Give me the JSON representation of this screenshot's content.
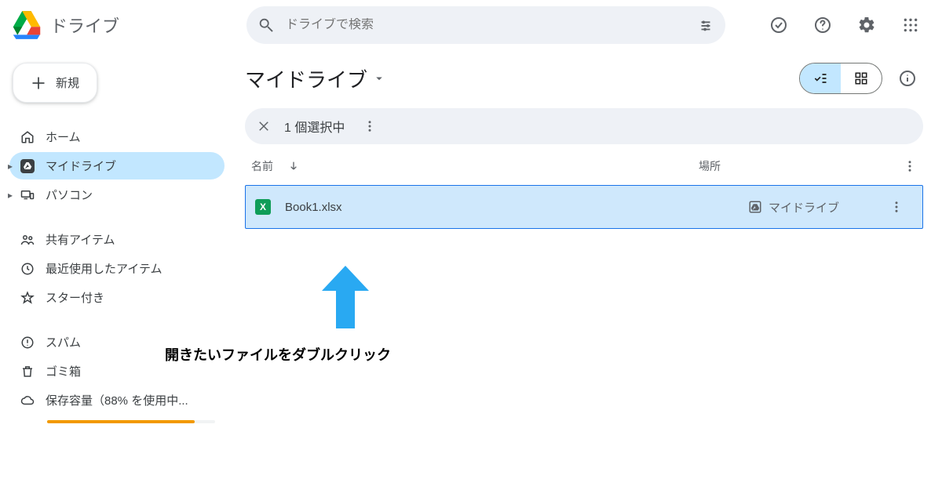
{
  "app_name": "ドライブ",
  "search": {
    "placeholder": "ドライブで検索"
  },
  "new_button": "新規",
  "sidebar": {
    "home": "ホーム",
    "my_drive": "マイドライブ",
    "computers": "パソコン",
    "shared": "共有アイテム",
    "recent": "最近使用したアイテム",
    "starred": "スター付き",
    "spam": "スパム",
    "trash": "ゴミ箱",
    "storage": "保存容量（88% を使用中..."
  },
  "main": {
    "breadcrumb": "マイドライブ",
    "selection_text": "1 個選択中",
    "columns": {
      "name": "名前",
      "location": "場所"
    },
    "file": {
      "name": "Book1.xlsx",
      "location": "マイドライブ",
      "icon_letter": "X"
    }
  },
  "annotation": "開きたいファイルをダブルクリック"
}
